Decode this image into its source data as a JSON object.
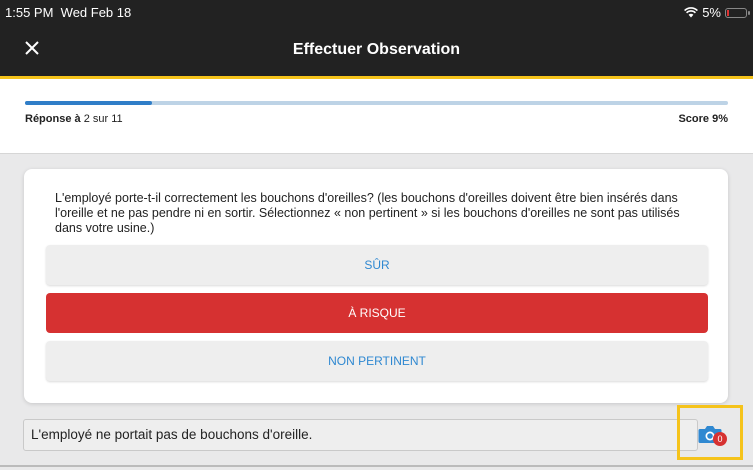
{
  "status": {
    "time": "1:55 PM",
    "date": "Wed Feb 18",
    "battery": "5%"
  },
  "header": {
    "title": "Effectuer Observation",
    "close_icon": "close-icon"
  },
  "progress": {
    "label_bold": "Réponse à",
    "label_rest": "2 sur 11",
    "score": "Score 9%",
    "fraction": 0.18,
    "accent_color": "#f5c31b",
    "bar_color": "#2f7ec8"
  },
  "question": {
    "text": "L'employé porte-t-il correctement les bouchons d'oreilles?   (les bouchons d'oreilles doivent être bien insérés dans l'oreille et ne pas pendre ni en sortir. Sélectionnez « non pertinent » si les bouchons d'oreilles ne sont pas utilisés dans votre usine.)",
    "options": [
      "SÛR",
      "À RISQUE",
      "NON PERTINENT"
    ],
    "selected": "À RISQUE",
    "risk_color": "#d63131"
  },
  "comment": {
    "value": "L'employé ne portait pas de bouchons d'oreille."
  },
  "camera": {
    "icon": "camera-icon",
    "badge_count": "0"
  }
}
